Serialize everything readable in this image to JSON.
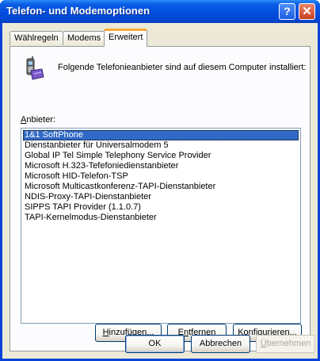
{
  "window": {
    "title": "Telefon- und Modemoptionen"
  },
  "titlebar": {
    "help_glyph": "?",
    "close_glyph": "✕"
  },
  "tabs": [
    {
      "label": "Wählregeln",
      "active": false
    },
    {
      "label": "Modems",
      "active": false
    },
    {
      "label": "Erweitert",
      "active": true
    }
  ],
  "panel": {
    "icon": "phone-icon",
    "intro": "Folgende Telefonieanbieter sind auf diesem Computer installiert:",
    "list_label_first": "A",
    "list_label_rest": "nbieter:",
    "providers": [
      "1&1 SoftPhone",
      "Dienstanbieter für Universalmodem 5",
      "Global IP Tel Simple Telephony Service Provider",
      "Microsoft H.323-Tefefoniedienstanbieter",
      "Microsoft HID-Telefon-TSP",
      "Microsoft Multicastkonferenz-TAPI-Dienstanbieter",
      "NDIS-Proxy-TAPI-Dienstanbieter",
      "SIPPS TAPI Provider (1.1.0.7)",
      "TAPI-Kernelmodus-Dienstanbieter"
    ],
    "selected_index": 0
  },
  "buttons": {
    "add_first": "H",
    "add_rest": "inzufügen...",
    "remove_pre": "E",
    "remove_first": "n",
    "remove_rest": "tfernen",
    "configure_first": "K",
    "configure_rest": "onfigurieren...",
    "ok": "OK",
    "cancel": "Abbrechen",
    "apply_first": "Ü",
    "apply_rest": "bernehmen"
  },
  "colors": {
    "selection": "#316ac5",
    "tab_accent": "#f7a934",
    "titlebar": "#0450e0"
  }
}
